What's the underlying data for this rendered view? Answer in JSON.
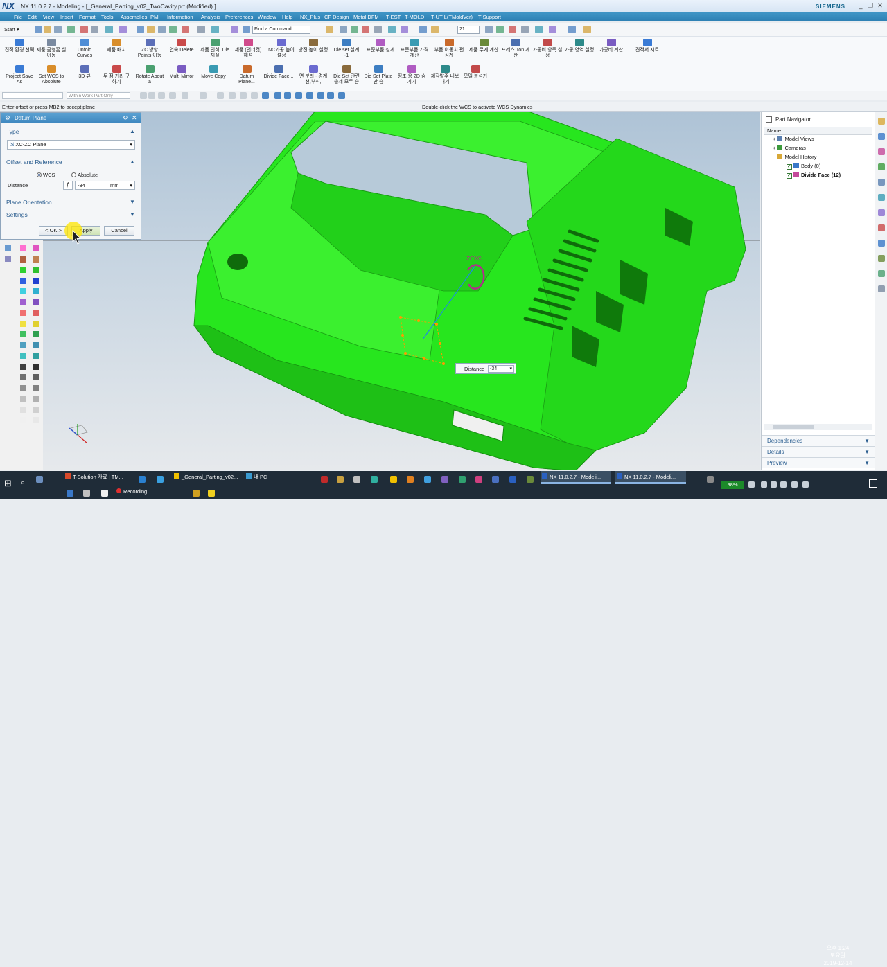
{
  "app": {
    "logo": "NX",
    "title": "NX 11.0.2.7 - Modeling - [_General_Parting_v02_TwoCavity.prt (Modified) ]",
    "brand": "SIEMENS"
  },
  "menu": [
    "File",
    "Edit",
    "View",
    "Insert",
    "Format",
    "Tools",
    "Assemblies",
    "PMI",
    "Information",
    "Analysis",
    "Preferences",
    "Window",
    "Help",
    "NX_Plus",
    "CF Design",
    "Metal DFM",
    "T-EST",
    "T-MOLD",
    "T-UTIL(TMoldVer)",
    "T-Support"
  ],
  "toolbar": {
    "start_label": "Start",
    "find_placeholder": "Find a Command",
    "zoom_value": "21"
  },
  "ribbon_row1": [
    {
      "label": "견적 환경 선택",
      "color": "#3a7bd5"
    },
    {
      "label": "제품 금형홈 실 이동",
      "color": "#7a8aa0"
    },
    {
      "label": "Unfold Curves",
      "color": "#4e8dd6"
    },
    {
      "label": "제품 배치",
      "color": "#d98e2b"
    },
    {
      "label": "ZC 방향 Points 이동",
      "color": "#5c6fb8"
    },
    {
      "label": "연속 Delete",
      "color": "#c94a4a"
    },
    {
      "label": "제품 인식, Die 재질",
      "color": "#4aa070"
    },
    {
      "label": "제품 (언더컷) 해석",
      "color": "#d04b8b"
    },
    {
      "label": "NC가공 높이 설정",
      "color": "#6b6bd0"
    },
    {
      "label": "방전 높이 설정",
      "color": "#8a6b3c"
    },
    {
      "label": "Die set 설계 -1",
      "color": "#3d7ec2"
    },
    {
      "label": "표준부품 설계",
      "color": "#b05cc2"
    },
    {
      "label": "표준부품 가격 계산",
      "color": "#3a9bb3"
    },
    {
      "label": "부품 이동치 편심계",
      "color": "#c96a2b"
    },
    {
      "label": "제품 무게 계산",
      "color": "#6a8a3a"
    },
    {
      "label": "프레스 Ton 계산",
      "color": "#4b6fb0"
    },
    {
      "label": "가공비 항목 설정",
      "color": "#c24a4a"
    },
    {
      "label": "가공 영역 설정",
      "color": "#2d8a8a"
    },
    {
      "label": "가공비 계산",
      "color": "#7a5cc2"
    },
    {
      "label": "견적서 시트",
      "color": "#3a7bd5"
    }
  ],
  "ribbon_row2": [
    {
      "label": "Project Save As",
      "color": "#3a7bd5"
    },
    {
      "label": "Set WCS to Absolute",
      "color": "#d98e2b"
    },
    {
      "label": "3D 뷰",
      "color": "#5c6fb8"
    },
    {
      "label": "두 점 거리 구하기",
      "color": "#c94a4a"
    },
    {
      "label": "Rotate About a",
      "color": "#4aa070"
    },
    {
      "label": "Multi Mirror",
      "color": "#7a5cc2"
    },
    {
      "label": "Move Copy",
      "color": "#3a9bb3"
    },
    {
      "label": "Datum Plane...",
      "color": "#c96a2b"
    },
    {
      "label": "Divide Face...",
      "color": "#4b6fb0"
    },
    {
      "label": "면 분리 - 경계선,부식,",
      "color": "#6b6bd0"
    },
    {
      "label": "Die Set 관련 솔제 모두 숨",
      "color": "#8a6b3c"
    },
    {
      "label": "Die Set Plate 만 숨",
      "color": "#3d7ec2"
    },
    {
      "label": "정조 용 2D 숨기기",
      "color": "#b05cc2"
    },
    {
      "label": "제작발주 내보내기",
      "color": "#2d8a8a"
    },
    {
      "label": "모델 분석기",
      "color": "#c24a4a"
    }
  ],
  "toolbar3": {
    "filter_value": "",
    "scope_value": "Within Work Part Only"
  },
  "cue": {
    "left": "Enter offset or press MB2 to accept plane",
    "right": "Double-click the WCS to activate WCS Dynamics"
  },
  "dialog": {
    "title": "Datum Plane",
    "type_header": "Type",
    "type_value": "XC-ZC Plane",
    "offset_header": "Offset and Reference",
    "radio_wcs": "WCS",
    "radio_absolute": "Absolute",
    "selected_reference": "WCS",
    "distance_label": "Distance",
    "distance_value": "-34",
    "distance_unit": "mm",
    "plane_orientation": "Plane Orientation",
    "settings": "Settings",
    "ok": "< OK >",
    "apply": "Apply",
    "cancel": "Cancel"
  },
  "viewport": {
    "handle_label": "ZCYC",
    "popup_label": "Distance",
    "popup_value": "-34",
    "part_color": "#27e61e"
  },
  "nav": {
    "title": "Part Navigator",
    "column": "Name",
    "items": [
      {
        "label": "Model Views"
      },
      {
        "label": "Cameras"
      },
      {
        "label": "Model History"
      },
      {
        "label": "Body (0)"
      },
      {
        "label": "Divide Face (12)"
      }
    ],
    "panels": [
      "Dependencies",
      "Details",
      "Preview"
    ]
  },
  "palette": [
    "#ff70d0",
    "#e054c0",
    "#b06040",
    "#c08050",
    "#30d030",
    "#30c030",
    "#3060e0",
    "#2040d0",
    "#40d0e0",
    "#30b0d0",
    "#a060d0",
    "#8050c0",
    "#f07070",
    "#e06060",
    "#f0e040",
    "#e0d030",
    "#40c060",
    "#30a050",
    "#50a0c0",
    "#4090b0",
    "#40c0c0",
    "#30a0a0",
    "#404040",
    "#303030",
    "#707070",
    "#606060",
    "#909090",
    "#808080",
    "#c0c0c0",
    "#b0b0b0",
    "#e0e0e0",
    "#d0d0d0",
    "#f0f0f0",
    "#e8e8e8"
  ],
  "taskbar": {
    "row1": [
      {
        "label": "T-Solution 자료 | TM..."
      },
      {
        "label": "_General_Parting_v02..."
      },
      {
        "label": "내 PC"
      },
      {
        "label": "NX 11.0.2.7 - Modeli..."
      },
      {
        "label": "NX 11.0.2.7 - Modeli..."
      }
    ],
    "row2": [
      {
        "label": "Recording..."
      }
    ],
    "battery": "98%",
    "time": "오후 1:24",
    "weekday": "토요일",
    "date": "2019-12-14"
  }
}
